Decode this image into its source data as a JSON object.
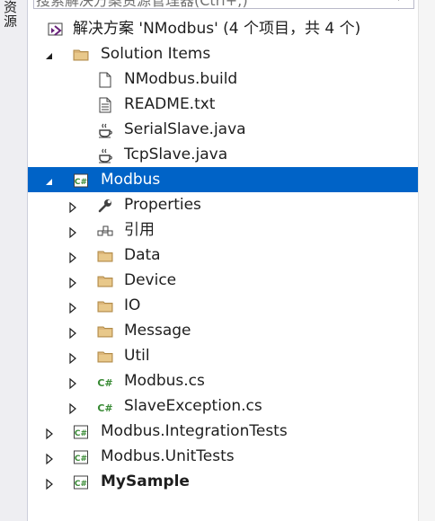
{
  "side_panel": {
    "tab_label": "资源"
  },
  "search": {
    "placeholder": "搜索解决方案资源管理器(Ctrl+;)"
  },
  "tree": {
    "solution_label": "解决方案 'NModbus' (4 个项目，共 4 个)",
    "items": [
      {
        "label": "Solution Items",
        "icon": "folder-icon"
      },
      {
        "label": "NModbus.build",
        "icon": "file-icon"
      },
      {
        "label": "README.txt",
        "icon": "text-file-icon"
      },
      {
        "label": "SerialSlave.java",
        "icon": "java-icon"
      },
      {
        "label": "TcpSlave.java",
        "icon": "java-icon"
      },
      {
        "label": "Modbus",
        "icon": "csharp-project-icon",
        "selected": true
      },
      {
        "label": "Properties",
        "icon": "wrench-icon"
      },
      {
        "label": "引用",
        "icon": "references-icon"
      },
      {
        "label": "Data",
        "icon": "folder-icon"
      },
      {
        "label": "Device",
        "icon": "folder-icon"
      },
      {
        "label": "IO",
        "icon": "folder-icon"
      },
      {
        "label": "Message",
        "icon": "folder-icon"
      },
      {
        "label": "Util",
        "icon": "folder-icon"
      },
      {
        "label": "Modbus.cs",
        "icon": "csharp-file-icon"
      },
      {
        "label": "SlaveException.cs",
        "icon": "csharp-file-icon"
      },
      {
        "label": "Modbus.IntegrationTests",
        "icon": "csharp-project-icon"
      },
      {
        "label": "Modbus.UnitTests",
        "icon": "csharp-project-icon"
      },
      {
        "label": "MySample",
        "icon": "csharp-project-icon",
        "bold": true
      }
    ]
  },
  "colors": {
    "selection": "#0063c7",
    "folder": "#dcb67a",
    "csharp_green": "#388a34",
    "vs_purple": "#68217a"
  }
}
